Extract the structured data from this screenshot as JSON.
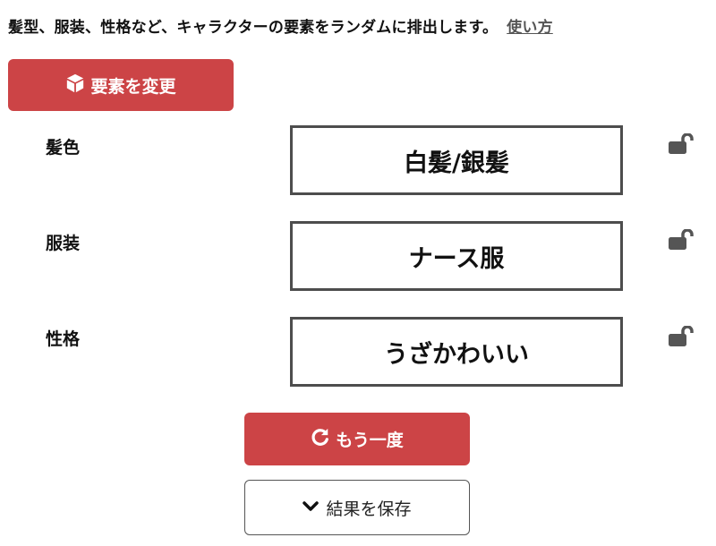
{
  "intro": {
    "text": "髪型、服装、性格など、キャラクターの要素をランダムに排出します。",
    "link_label": "使い方"
  },
  "buttons": {
    "change_elements": {
      "label": "要素を変更",
      "icon": "cube-icon"
    },
    "retry": {
      "label": "もう一度",
      "icon": "redo-icon"
    },
    "save": {
      "label": "結果を保存",
      "icon": "chevron-down-icon"
    }
  },
  "elements": [
    {
      "label": "髪色",
      "value": "白髪/銀髪",
      "locked": false,
      "lock_icon": "unlock-icon"
    },
    {
      "label": "服装",
      "value": "ナース服",
      "locked": false,
      "lock_icon": "unlock-icon"
    },
    {
      "label": "性格",
      "value": "うざかわいい",
      "locked": false,
      "lock_icon": "unlock-icon"
    }
  ],
  "colors": {
    "accent": "#cc4446",
    "box_border": "#4d4d4d",
    "lock": "#555555"
  }
}
